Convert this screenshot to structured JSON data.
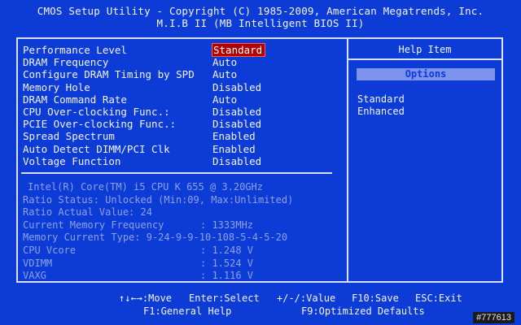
{
  "title": {
    "line1": "CMOS Setup Utility - Copyright (C) 1985-2009, American Megatrends, Inc.",
    "line2": "M.I.B II (MB Intelligent BIOS II)"
  },
  "settings": [
    {
      "label": "Performance Level",
      "value": "Standard"
    },
    {
      "label": "DRAM Frequency",
      "value": "Auto"
    },
    {
      "label": "Configure DRAM Timing by SPD",
      "value": "Auto"
    },
    {
      "label": "Memory Hole",
      "value": "Disabled"
    },
    {
      "label": "DRAM Command Rate",
      "value": "Auto"
    },
    {
      "label": "CPU Over-clocking Func.:",
      "value": "Disabled"
    },
    {
      "label": "PCIE Over-clocking Func.:",
      "value": "Disabled"
    },
    {
      "label": "Spread Spectrum",
      "value": "Enabled"
    },
    {
      "label": "Auto Detect DIMM/PCI Clk",
      "value": "Enabled"
    },
    {
      "label": "Voltage Function",
      "value": "Disabled"
    }
  ],
  "info": {
    "cpu": "Intel(R) Core(TM) i5 CPU        K 655  @ 3.20GHz",
    "ratio_status": "Ratio Status: Unlocked (Min:09, Max:Unlimited)",
    "ratio_actual": "Ratio Actual Value: 24",
    "mem_freq_label": "Current Memory Frequency",
    "mem_freq_value": ": 1333MHz",
    "mem_type": "Memory Current Type: 9-24-9-9-10-108-5-4-5-20",
    "vcore_label": "CPU Vcore",
    "vcore_value": ": 1.248 V",
    "vdimm_label": "VDIMM",
    "vdimm_value": ": 1.524 V",
    "vaxg_label": "VAXG",
    "vaxg_value": ": 1.116 V"
  },
  "help": {
    "title": "Help Item",
    "options_label": "Options",
    "options": [
      "Standard",
      "Enhanced"
    ]
  },
  "footer": {
    "move": "↑↓←→:Move",
    "enter": "Enter:Select",
    "value": "+/-/:Value",
    "save": "F10:Save",
    "exit": "ESC:Exit",
    "help": "F1:General Help",
    "defaults": "F9:Optimized Defaults"
  },
  "watermark": "#777613",
  "colors": {
    "background": "#0d3bd6",
    "text": "#f2f4ff",
    "dim_text": "#8fa1e8",
    "selected_bg": "#b00000",
    "options_bar": "#7d93ee"
  }
}
